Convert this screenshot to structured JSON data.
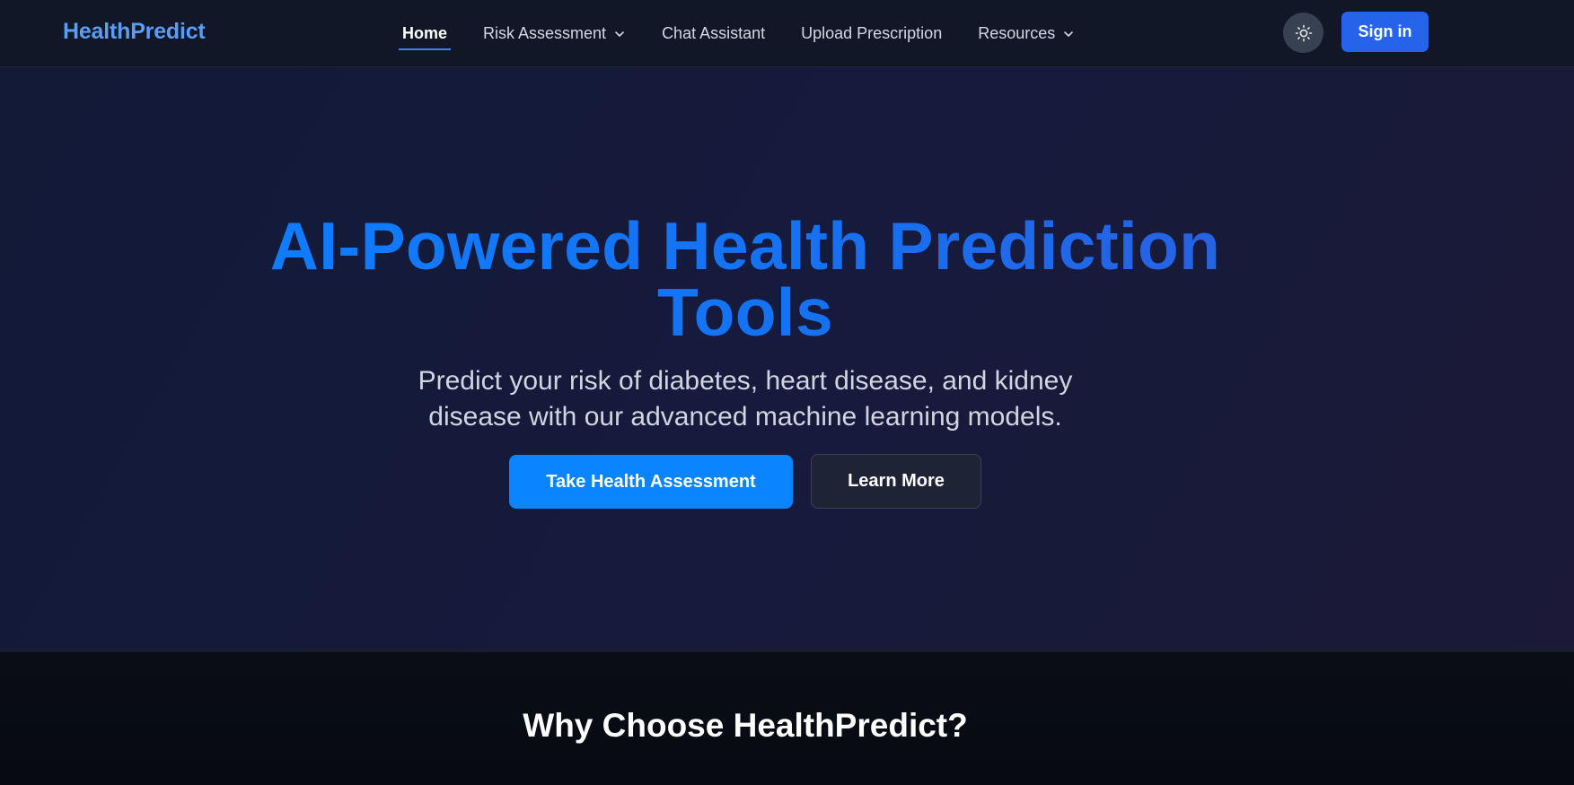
{
  "navbar": {
    "logo": "HealthPredict",
    "links": [
      {
        "label": "Home",
        "active": true
      },
      {
        "label": "Risk Assessment",
        "has_dropdown": true
      },
      {
        "label": "Chat Assistant"
      },
      {
        "label": "Upload Prescription"
      },
      {
        "label": "Resources",
        "has_dropdown": true
      }
    ],
    "theme_toggle_icon": "sun-icon",
    "signin_label": "Sign in"
  },
  "hero": {
    "title_line1": "AI-Powered Health Prediction",
    "title_line2": "Tools",
    "subtitle_line1": "Predict your risk of diabetes, heart disease, and kidney",
    "subtitle_line2": "disease with our advanced machine learning models.",
    "primary_button": "Take Health Assessment",
    "secondary_button": "Learn More"
  },
  "why": {
    "title": "Why Choose HealthPredict?"
  },
  "colors": {
    "accent": "#2563eb",
    "logo": "#5b9cf5",
    "primary_button": "#0a84ff",
    "background": "#0a0d16"
  }
}
